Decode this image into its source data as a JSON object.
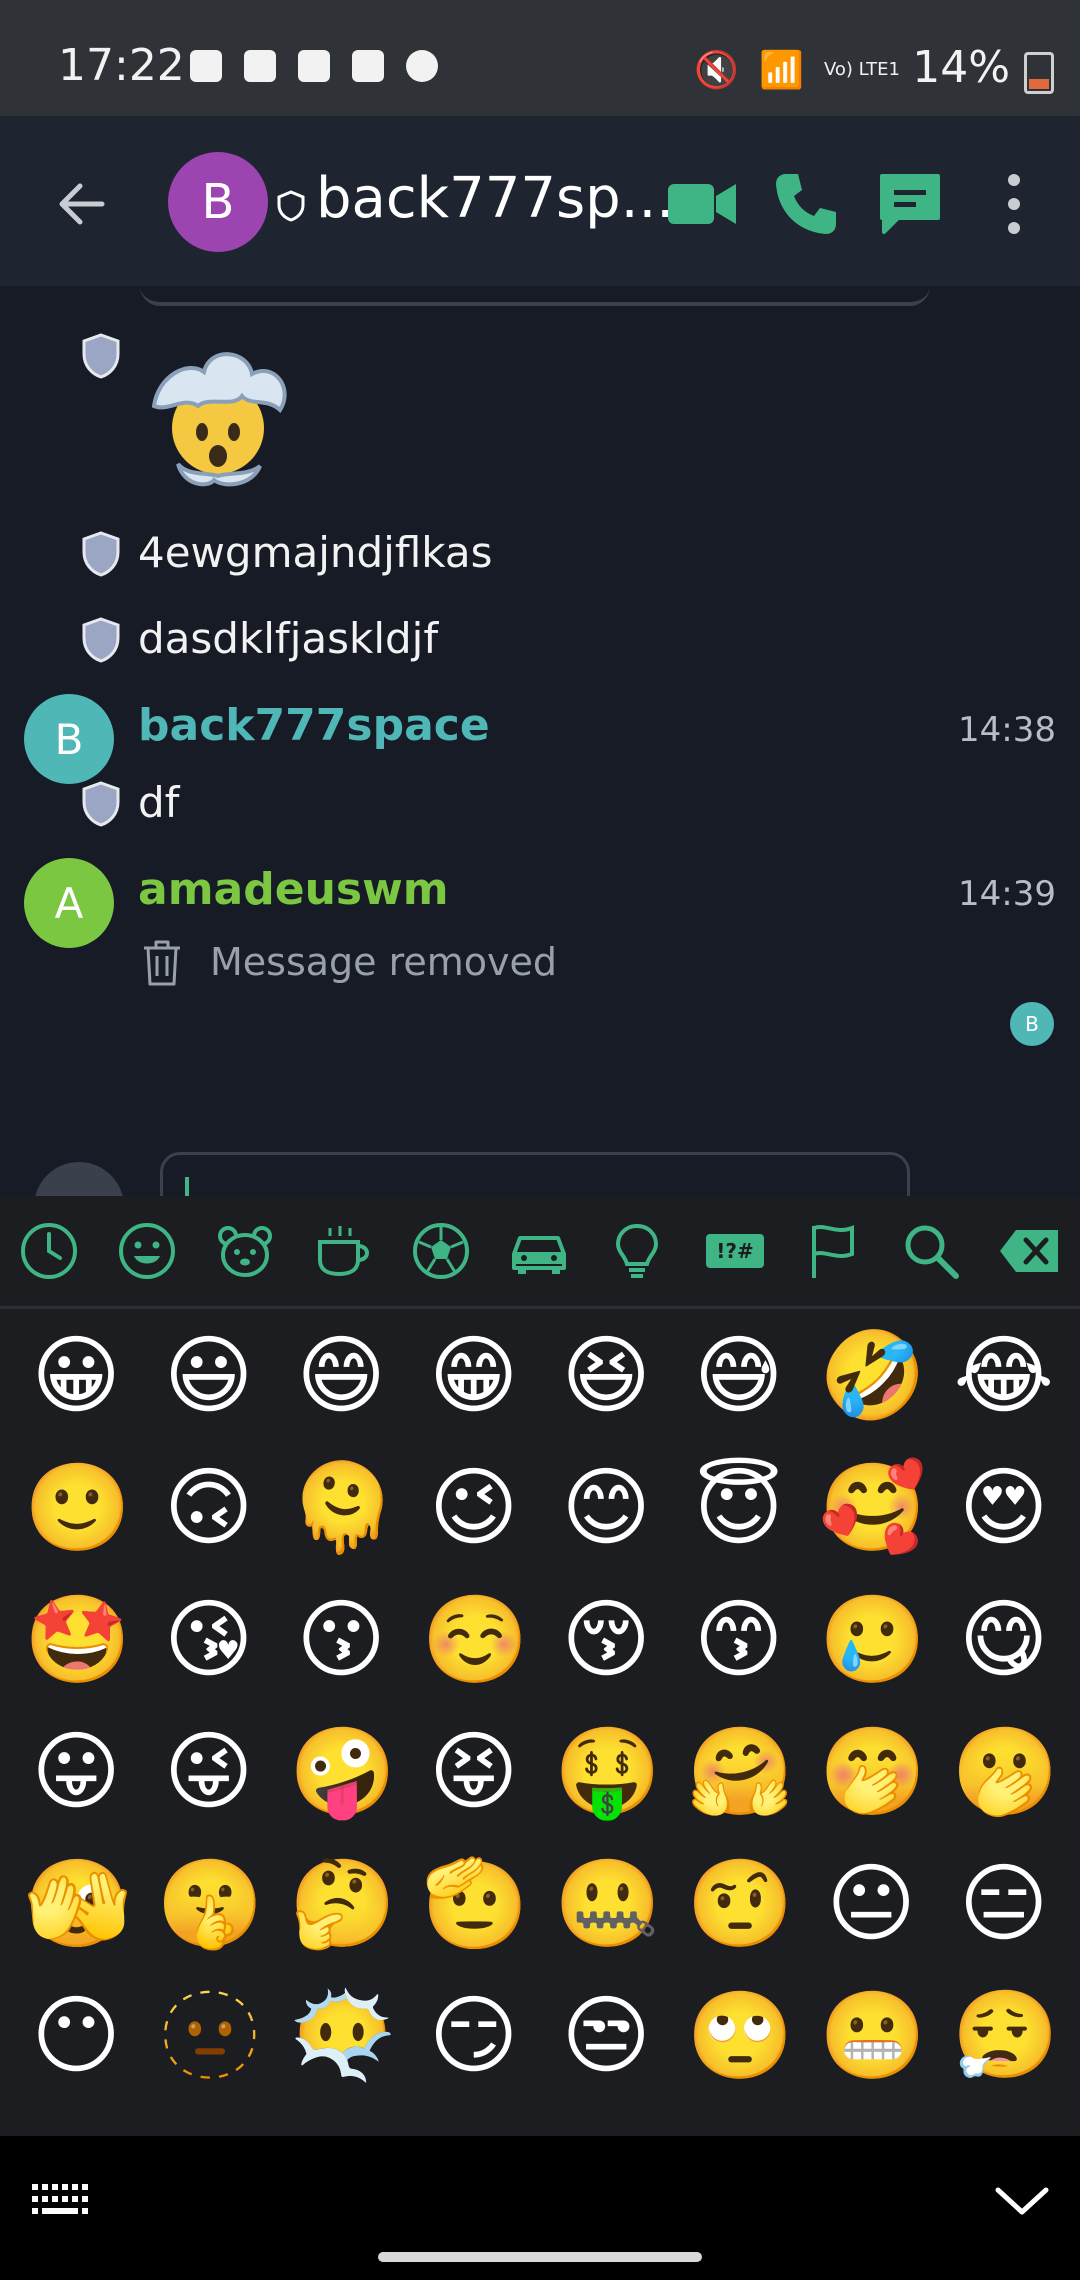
{
  "status_bar": {
    "time": "17:22",
    "battery": "14%",
    "network": "Vo) LTE1"
  },
  "header": {
    "avatar_letter": "B",
    "room_name": "back777sp..."
  },
  "messages": {
    "m1_text": "4ewgmajndjflkas",
    "m2_text": "dasdklfjaskldjf",
    "sender1_letter": "B",
    "sender1": "back777space",
    "sender1_time": "14:38",
    "m3_text": "df",
    "sender2_letter": "A",
    "sender2": "amadeuswm",
    "sender2_time": "14:39",
    "removed_text": "Message removed",
    "read_receipt_letter": "B"
  },
  "emoji_keyboard": {
    "categories": [
      "recent-icon",
      "smileys-icon",
      "animals-icon",
      "food-icon",
      "activity-icon",
      "travel-icon",
      "objects-icon",
      "symbols-icon",
      "flags-icon",
      "search-icon",
      "backspace-icon"
    ],
    "rows": [
      [
        "😀",
        "😃",
        "😄",
        "😁",
        "😆",
        "😅",
        "🤣",
        "😂"
      ],
      [
        "🙂",
        "🙃",
        "🫠",
        "😉",
        "😊",
        "😇",
        "🥰",
        "😍"
      ],
      [
        "🤩",
        "😘",
        "😗",
        "☺️",
        "😚",
        "😙",
        "🥲",
        "😋"
      ],
      [
        "😛",
        "😜",
        "🤪",
        "😝",
        "🤑",
        "🤗",
        "🤭",
        "🫢"
      ],
      [
        "🫣",
        "🤫",
        "🤔",
        "🫡",
        "🤐",
        "🤨",
        "😐",
        "😑"
      ],
      [
        "😶",
        "🫥",
        "😶‍🌫️",
        "😏",
        "😒",
        "🙄",
        "😬",
        "😮‍💨"
      ]
    ]
  },
  "colors": {
    "accent": "#3fb585",
    "sender1": "#4fb7b6",
    "sender2": "#7bc742",
    "avatar_purple": "#9c44b0"
  }
}
